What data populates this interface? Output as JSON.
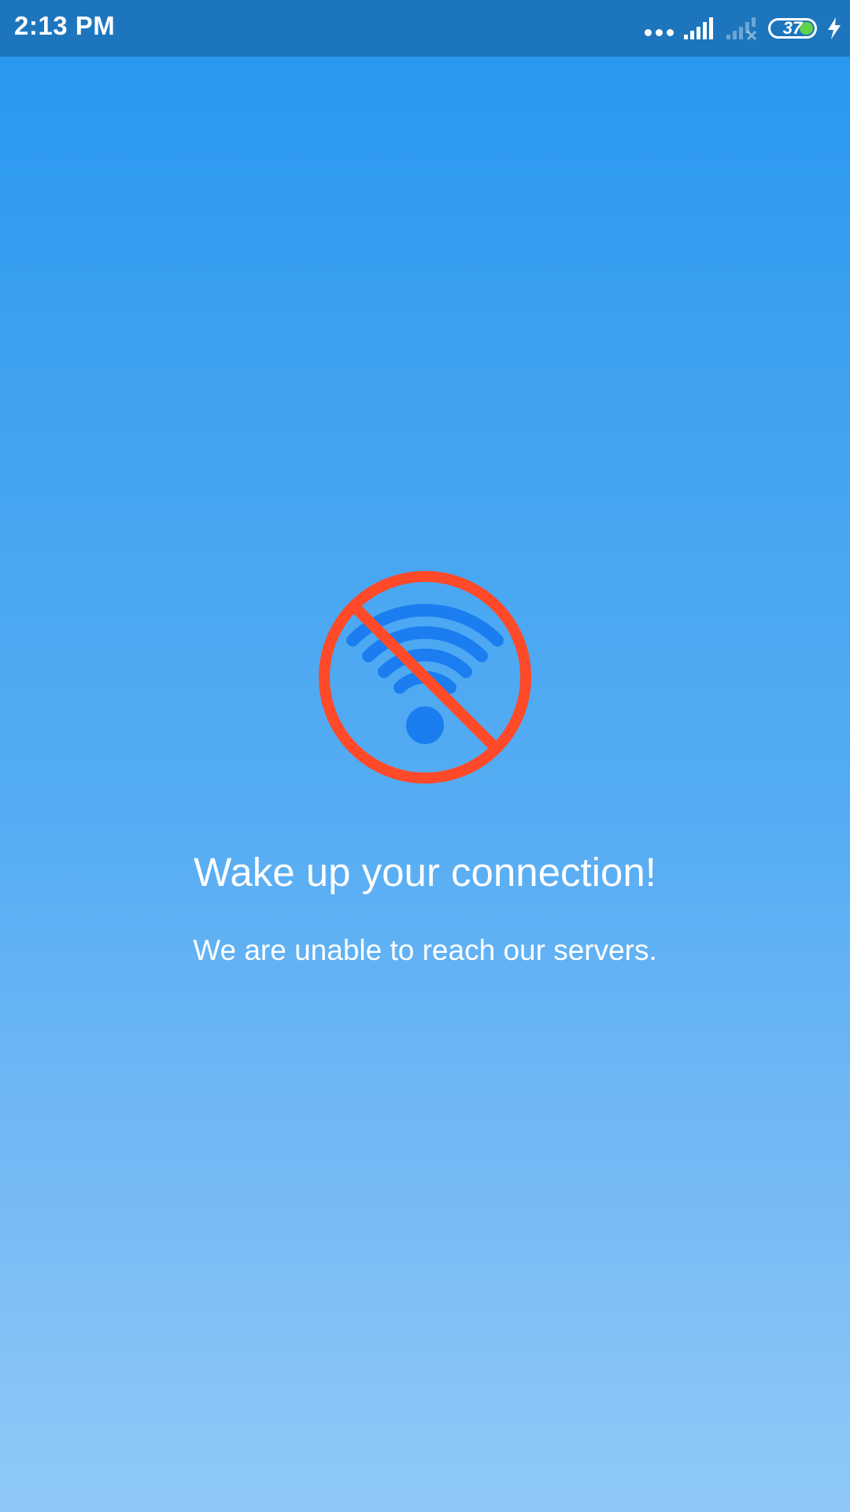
{
  "status_bar": {
    "time": "2:13 PM",
    "battery_level": "37",
    "battery_fraction": 0.37,
    "icons": [
      "more-dots-icon",
      "signal-icon",
      "no-signal-icon",
      "battery-icon",
      "charging-icon"
    ]
  },
  "error": {
    "icon": "no-wifi-icon",
    "title": "Wake up your connection!",
    "message": "We are unable to reach our servers."
  },
  "colors": {
    "status_bar": "#1d76bd",
    "background_top": "#2596ef",
    "background_bottom": "#90c9f8",
    "prohibit_red": "#ff4a2a",
    "wifi_blue": "#1a7ef0"
  }
}
